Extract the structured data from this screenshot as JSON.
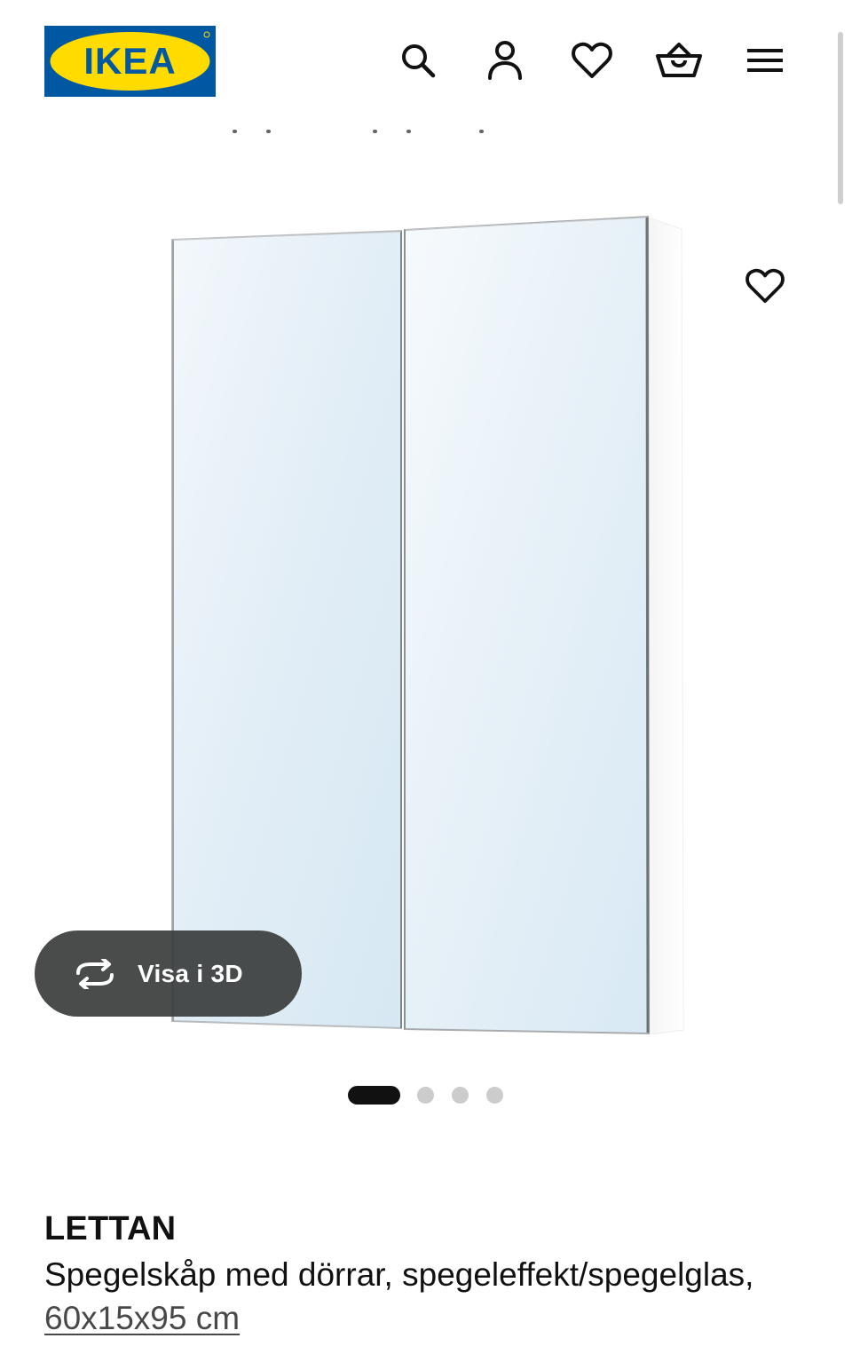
{
  "header": {
    "logo_text": "IKEA",
    "icons": {
      "search": "search-icon",
      "profile": "profile-icon",
      "favourites": "heart-icon",
      "cart": "shopping-bag-icon",
      "menu": "hamburger-menu-icon"
    },
    "colors": {
      "logo_blue": "#0058a3",
      "logo_yellow": "#ffdb00"
    }
  },
  "gallery": {
    "view_3d_label": "Visa i 3D",
    "view_3d_icon": "rotate-3d-icon",
    "favourite_icon": "heart-icon",
    "slide_count": 4,
    "active_slide": 1
  },
  "product": {
    "name": "LETTAN",
    "description": "Spegelskåp med dörrar, spegeleffekt/spegelglas, ",
    "measurement": "60x15x95 cm"
  }
}
